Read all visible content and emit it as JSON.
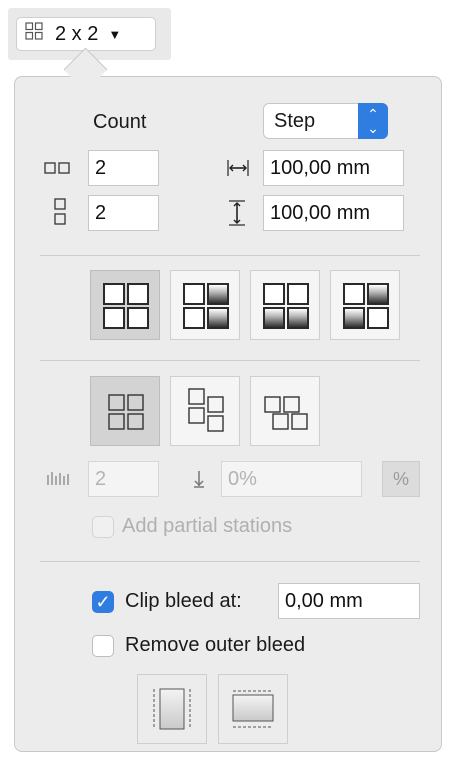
{
  "layout_button": {
    "label": "2 x 2",
    "icon": "grid-icon",
    "arrow": "chevron-down-icon"
  },
  "count": {
    "title": "Count",
    "mode_select": "Step",
    "columns": "2",
    "rows": "2",
    "horizontal_step": "100,00 mm",
    "vertical_step": "100,00 mm"
  },
  "arrangement": {
    "options": [
      "grid-uniform",
      "grid-right-column-gradient",
      "grid-bottom-row-gradient",
      "grid-top-right-gradient"
    ],
    "selected": 0
  },
  "stagger": {
    "options": [
      "aligned-grid",
      "vertical-staggered-grid",
      "horizontal-staggered-grid"
    ],
    "selected": 0,
    "offset_count": "2",
    "offset_percent": "0%",
    "percent_button": "%"
  },
  "partial": {
    "label": "Add partial stations",
    "checked": false,
    "enabled": false
  },
  "bleed": {
    "clip_label": "Clip bleed at:",
    "clip_checked": true,
    "clip_value": "0,00 mm",
    "remove_outer_label": "Remove outer bleed",
    "remove_outer_checked": false
  },
  "colors": {
    "accent": "#2f7de1",
    "panel": "#ececec",
    "selected_tile": "#d3d3d3"
  }
}
